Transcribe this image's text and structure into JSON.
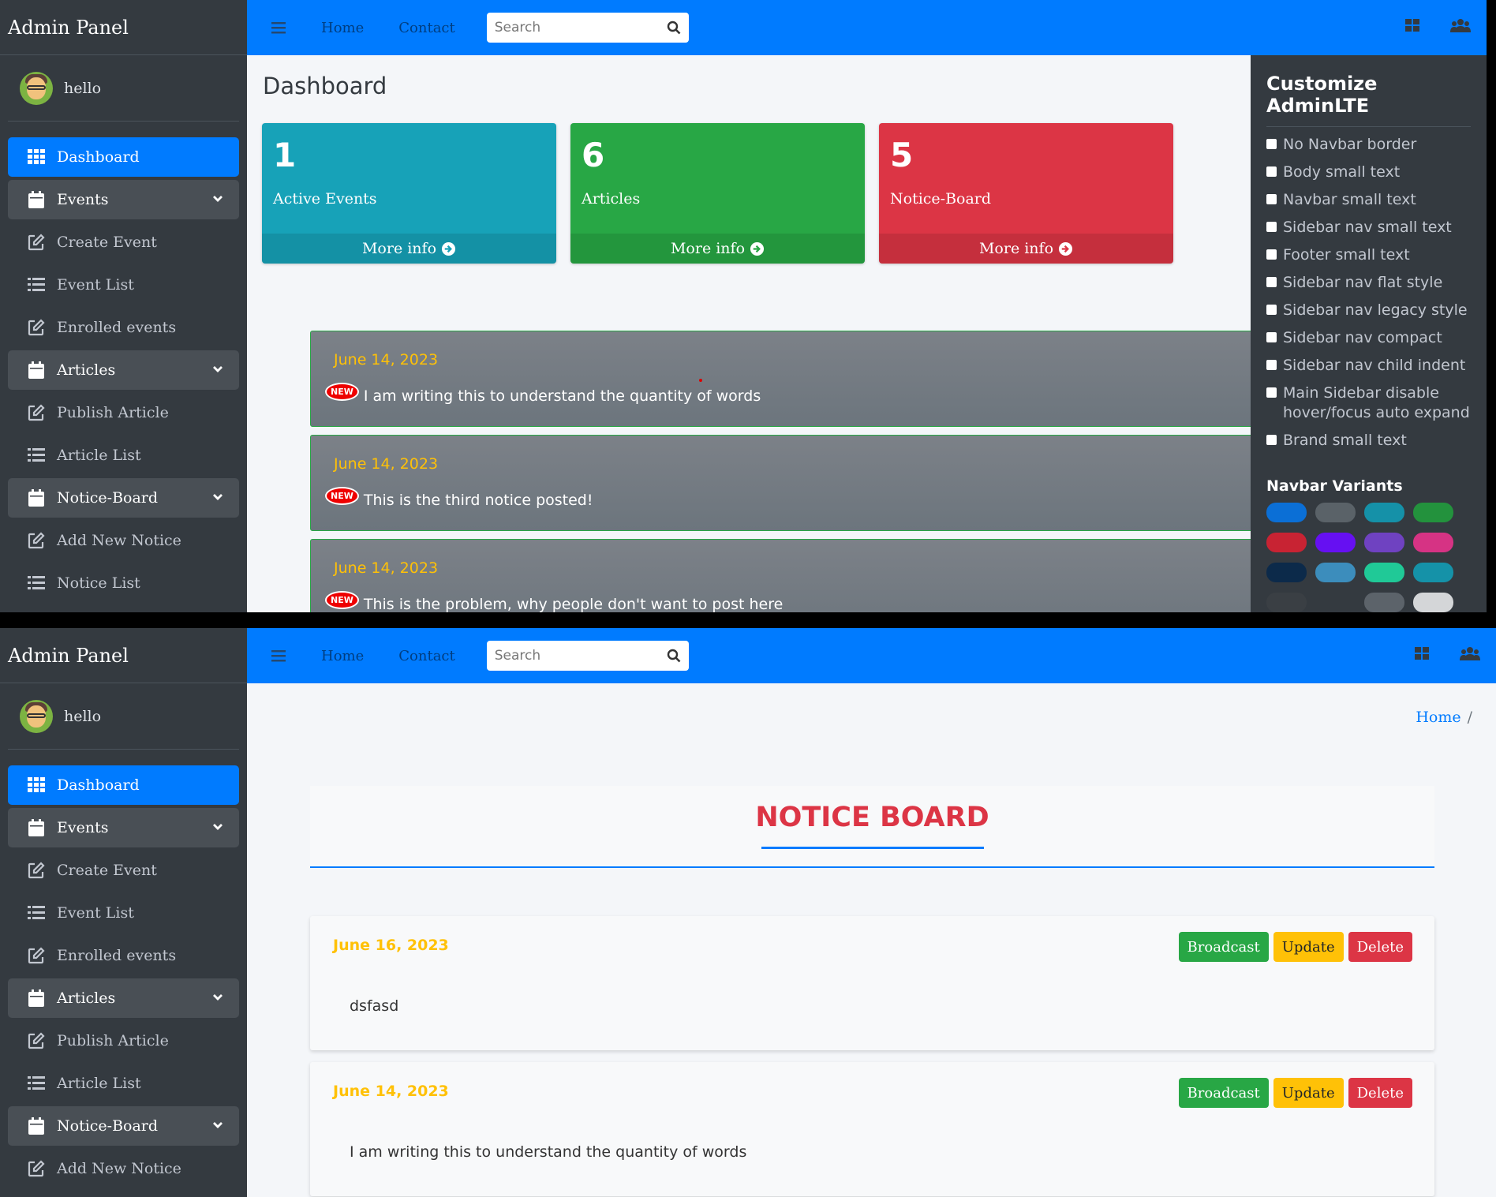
{
  "app": {
    "brand": "Admin Panel",
    "user": "hello"
  },
  "sidebar": {
    "items": [
      {
        "label": "Dashboard",
        "icon": "th-icon",
        "type": "active"
      },
      {
        "label": "Events",
        "icon": "calendar-icon",
        "type": "group"
      },
      {
        "label": "Create Event",
        "icon": "edit-icon",
        "type": "link"
      },
      {
        "label": "Event List",
        "icon": "list-icon",
        "type": "link"
      },
      {
        "label": "Enrolled events",
        "icon": "edit-icon",
        "type": "link"
      },
      {
        "label": "Articles",
        "icon": "calendar-icon",
        "type": "group"
      },
      {
        "label": "Publish Article",
        "icon": "edit-icon",
        "type": "link"
      },
      {
        "label": "Article List",
        "icon": "list-icon",
        "type": "link"
      },
      {
        "label": "Notice-Board",
        "icon": "calendar-icon",
        "type": "group"
      },
      {
        "label": "Add New Notice",
        "icon": "edit-icon",
        "type": "link"
      },
      {
        "label": "Notice List",
        "icon": "list-icon",
        "type": "link"
      }
    ]
  },
  "navbar": {
    "home": "Home",
    "contact": "Contact",
    "search_placeholder": "Search"
  },
  "dashboard": {
    "title": "Dashboard",
    "boxes": [
      {
        "count": "1",
        "label": "Active Events",
        "more": "More info",
        "color": "#17a2b8"
      },
      {
        "count": "6",
        "label": "Articles",
        "more": "More info",
        "color": "#28a745"
      },
      {
        "count": "5",
        "label": "Notice-Board",
        "more": "More info",
        "color": "#dc3545"
      }
    ],
    "new_badge": "NEW",
    "notices": [
      {
        "date": "June 14, 2023",
        "text": "I am writing this to understand the quantity of words"
      },
      {
        "date": "June 14, 2023",
        "text": "This is the third notice posted!"
      },
      {
        "date": "June 14, 2023",
        "text": "This is the problem, why people don't want to post here"
      }
    ]
  },
  "customize": {
    "title": "Customize AdminLTE",
    "options": [
      "No Navbar border",
      "Body small text",
      "Navbar small text",
      "Sidebar nav small text",
      "Footer small text",
      "Sidebar nav flat style",
      "Sidebar nav legacy style",
      "Sidebar nav compact",
      "Sidebar nav child indent",
      "Main Sidebar disable hover/focus auto expand",
      "Brand small text"
    ],
    "navbar_variants_title": "Navbar Variants",
    "swatches": [
      "#0b6fd6",
      "#5a6268",
      "#1591a8",
      "#23923d",
      "#c82333",
      "#6610f2",
      "#6f42c1",
      "#d63384",
      "#0c2a4a",
      "#3c8dbc",
      "#20c997",
      "#1592a8",
      "#3a3f44",
      "#343a40",
      "#5c636a",
      "#d4d6d8"
    ]
  },
  "noticeboard": {
    "breadcrumb": "Home",
    "breadcrumb_sep": "/",
    "title": "NOTICE BOARD",
    "buttons": {
      "broadcast": "Broadcast",
      "update": "Update",
      "delete": "Delete"
    },
    "cards": [
      {
        "date": "June 16, 2023",
        "text": "dsfasd"
      },
      {
        "date": "June 14, 2023",
        "text": "I am writing this to understand the quantity of words"
      }
    ]
  }
}
